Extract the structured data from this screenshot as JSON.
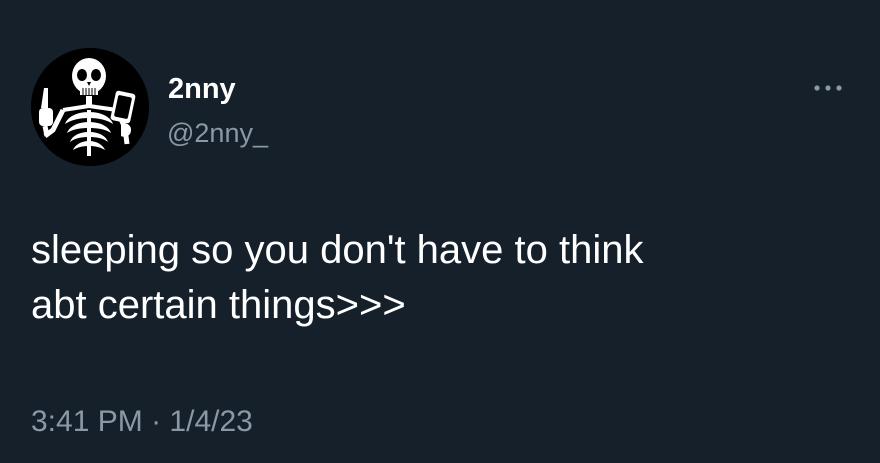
{
  "theme": {
    "background": "#15202b",
    "text_primary": "#ffffff",
    "text_secondary": "#8b98a5"
  },
  "author": {
    "display_name": "2nny",
    "handle": "@2nny_",
    "avatar_icon": "skeleton-avatar"
  },
  "menu": {
    "more_icon": "more-horizontal-icon"
  },
  "tweet": {
    "text_line_1": "sleeping so you don't have to think",
    "text_line_2": "abt certain things>>>",
    "time": "3:41 PM",
    "separator": "·",
    "date": "1/4/23"
  }
}
